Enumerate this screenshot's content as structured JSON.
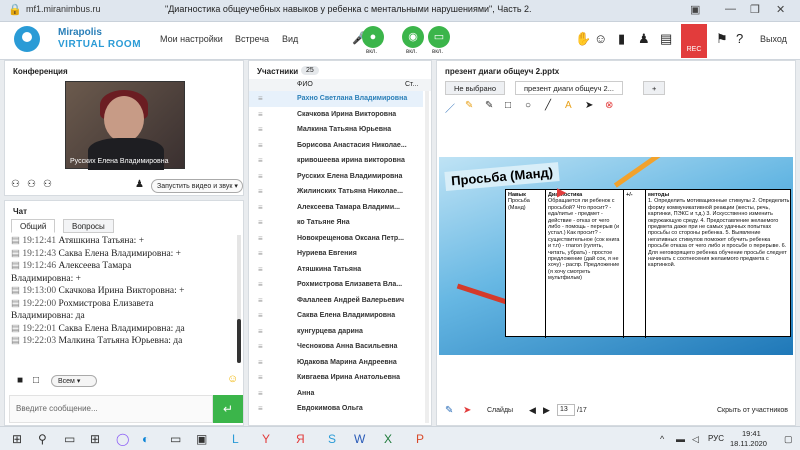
{
  "browser": {
    "url": "mf1.miranimbus.ru",
    "title": "\"Диагностика общеучебных навыков у ребенка с ментальными нарушениями\", Часть 2."
  },
  "header": {
    "brand_top": "Mirapolis",
    "brand_bottom": "VIRTUAL ROOM",
    "menu": [
      "Мои настройки",
      "Встреча",
      "Вид"
    ],
    "tools": [
      {
        "label": "вкл.",
        "color": "#3bb54a"
      },
      {
        "label": "вкл.",
        "color": "#3bb54a"
      },
      {
        "label": "вкл.",
        "color": "#3bb54a"
      }
    ],
    "rec_label": "REC",
    "exit_label": "Выход"
  },
  "conference": {
    "title": "Конференция",
    "video_caption": "Русских Елена Владимировна",
    "start_video": "Запустить видео и звук"
  },
  "chat": {
    "title": "Чат",
    "tabs": [
      "Общий",
      "Вопросы"
    ],
    "messages": [
      {
        "time": "19:12:41",
        "text": "Атяшкина Татьяна: +"
      },
      {
        "time": "19:12:43",
        "text": "Саква Елена Владимировна: +"
      },
      {
        "time": "19:12:46",
        "text": "Алексеева   Тамара"
      },
      {
        "time": "",
        "text": "Владимировна: +"
      },
      {
        "time": "19:13:00",
        "text": "Скачкова  Ирина Викторовна: +"
      },
      {
        "time": "19:22:00",
        "text": "Рохмистрова  Елизавета"
      },
      {
        "time": "",
        "text": "Владимировна: да"
      },
      {
        "time": "19:22:01",
        "text": "Саква Елена Владимировна: да"
      },
      {
        "time": "19:22:03",
        "text": "Малкина Татьяна  Юрьевна: да"
      }
    ],
    "to_label": "Всем",
    "input_placeholder": "Введите сообщение..."
  },
  "participants": {
    "title": "Участники",
    "count": "25",
    "col_name": "ФИО",
    "col_status": "Ст...",
    "list": [
      "Рахно Светлана  Владимировна",
      "Скачкова  Ирина Викторовна",
      "Малкина Татьяна  Юрьевна",
      "Борисова  Анастасия Николае...",
      "кривошеева ирина викторовна",
      "Русских Елена Владимировна",
      "Жилинских  Татьяна  Николае...",
      "Алексеева  Тамара  Владими...",
      "ко Татьяне Яна",
      "Новокрещенова  Оксана Петр...",
      "Нуриева Евгения",
      "Атяшкина Татьяна",
      "Рохмистрова  Елизавета Вла...",
      "Фалалеев  Андрей  Валерьевич",
      "Саква Елена Владимировна",
      "кунгурцева   дарина",
      "Чеснокова  Анна Васильевна",
      "Юдакова  Марина  Андреевна",
      "Кивгаева  Ирина  Анатольевна",
      "Анна",
      "Евдокимова Ольга"
    ]
  },
  "presentation": {
    "title": "презент диаги общеуч 2.pptx",
    "tabs": [
      "Не выбрано",
      "презент диаги общеуч 2..."
    ],
    "slide": {
      "title": "Просьба (Манд)",
      "col1_head": "Навык",
      "col1_body": "Просьба (Манд)",
      "col2_head": "Диагностика",
      "col2_body": "Обращается ли ребенок с просьбой? Что просит? - еда/питье - предмет - действие - отказ от чего либо - помощь - перерыв (и устал.) Как просит? - существительное (сок книга и т.п) - глагол (гулять, читать, убрать) - простое предложение (дай сок, я не хочу) - распр. Предложение (я хочу смотреть мультфильм)",
      "col3_head": "+/-",
      "col4_head": "методы",
      "col4_body": "1. Определить мотивационные стимулы 2. Определить форму коммуникативной реакции (жесты, речь, картинки, ПЭКС и т.д.) 3. Искусственно изменить окружающую среду. 4. Предоставление желаемого предмета даже при не самых удачных попытках просьбы со стороны ребенка. 5. Выявление негативных стимулов поможет обучить ребенка просьбе отказа от чего либо и просьбе о перерыве. 6. Для неговорящего ребенка обучение просьбе следует начинать с соотнесения желаемого предмета с картинкой."
    },
    "slides_label": "Слайды",
    "page": "13",
    "total": "/17",
    "hide_label": "Скрыть от участников"
  },
  "taskbar": {
    "lang": "РУС",
    "time": "19:41",
    "date": "18.11.2020"
  }
}
